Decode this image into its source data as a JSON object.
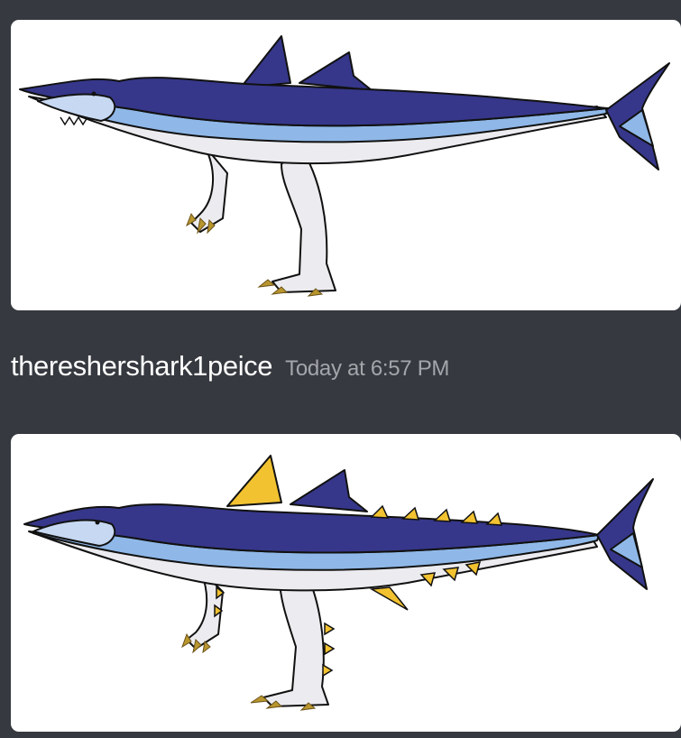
{
  "message": {
    "username": "thereshershark1peice",
    "timestamp": "Today at 6:57 PM"
  },
  "attachments": [
    {
      "subject": "shark-dinosaur drawing",
      "variant": "plain"
    },
    {
      "subject": "shark-dinosaur drawing",
      "variant": "yellow spines"
    }
  ],
  "colors": {
    "background": "#36393f",
    "username": "#ffffff",
    "timestamp": "#a3a6aa",
    "shark_dark_blue": "#36378a",
    "shark_light_blue": "#8fb8e8",
    "shark_belly": "#ececf0",
    "claws": "#b8962e",
    "spines": "#f2c230"
  }
}
